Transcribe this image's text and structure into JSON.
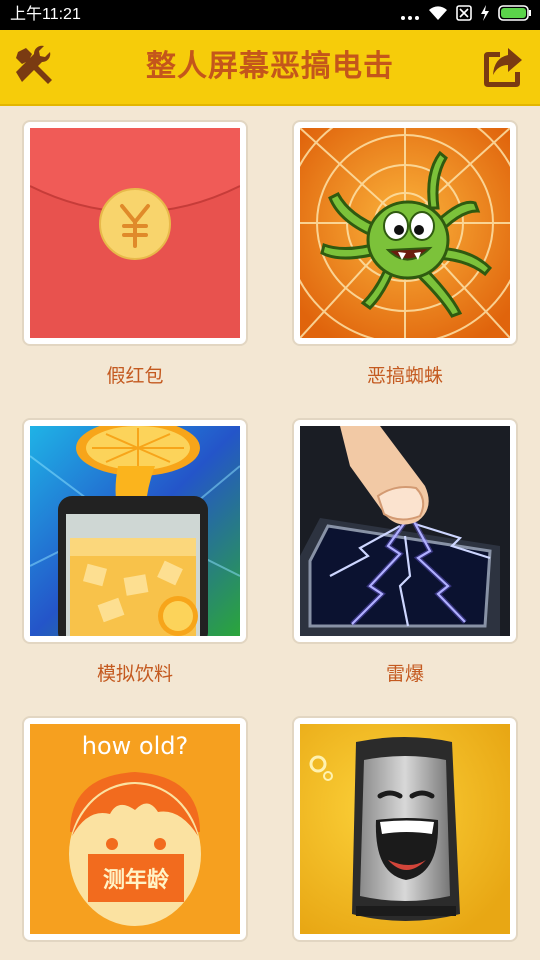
{
  "status_bar": {
    "time": "上午11:21",
    "icons": [
      "more-dots-icon",
      "wifi-icon",
      "no-sim-icon",
      "charging-icon",
      "battery-icon"
    ]
  },
  "app_bar": {
    "title": "整人屏幕恶搞电击",
    "left_icon": "tools-icon",
    "right_icon": "share-icon",
    "background": "#f6cc0a",
    "title_color": "#c4561b"
  },
  "items": [
    {
      "label": "假红包",
      "icon": "red-envelope-icon"
    },
    {
      "label": "恶搞蜘蛛",
      "icon": "spider-icon"
    },
    {
      "label": "模拟饮料",
      "icon": "juice-icon"
    },
    {
      "label": "雷爆",
      "icon": "lightning-icon"
    },
    {
      "label": "测年龄",
      "icon": "age-test-icon",
      "image_text": "how old?",
      "badge_text": "测年龄"
    },
    {
      "label": "",
      "icon": "laughing-phone-icon"
    }
  ]
}
